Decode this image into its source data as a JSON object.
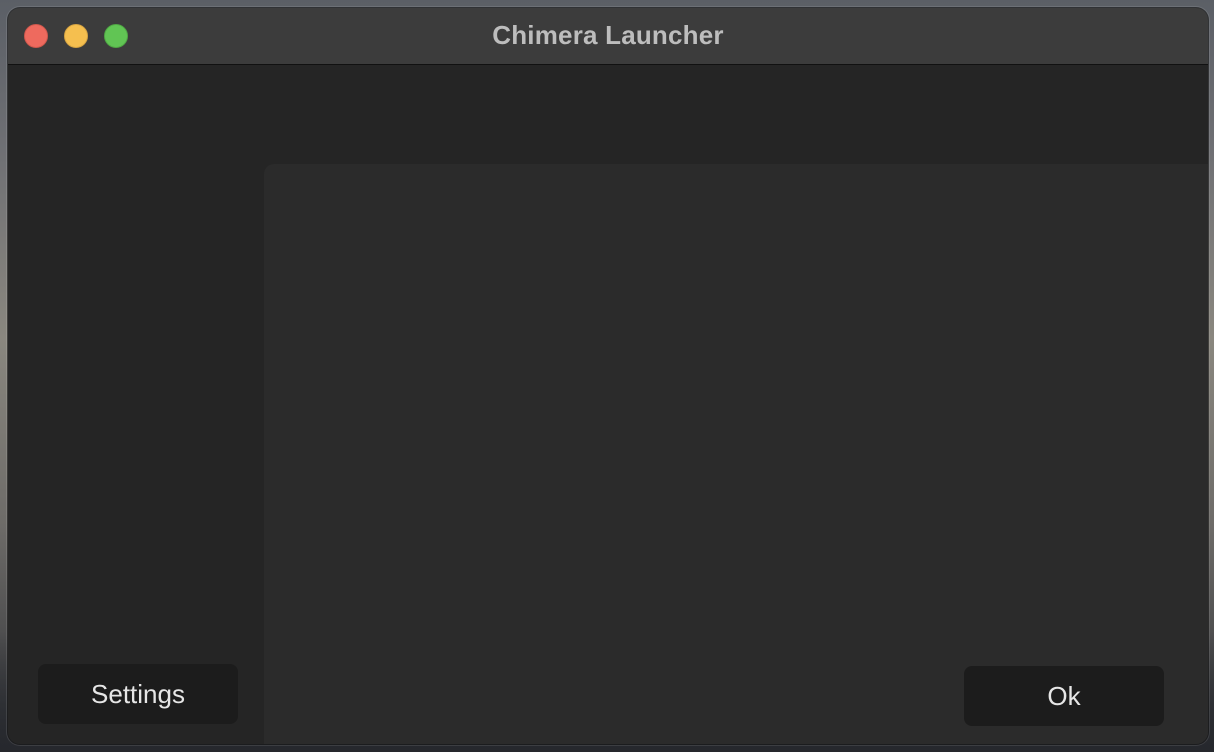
{
  "window": {
    "title": "Chimera Launcher"
  },
  "footer": {
    "settings_label": "Settings",
    "ok_label": "Ok"
  },
  "colors": {
    "close": "#ee6a5e",
    "minimize": "#f5bf4f",
    "zoom": "#61c554",
    "titlebar": "#3c3c3c",
    "sidebar": "#252525",
    "panel": "#2b2b2b",
    "button": "#1c1c1c"
  }
}
